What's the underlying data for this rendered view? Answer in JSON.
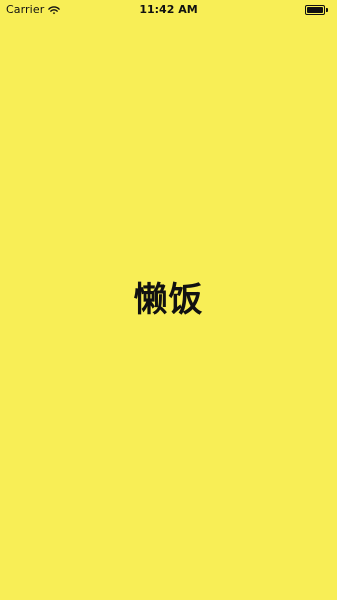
{
  "status_bar": {
    "carrier": "Carrier",
    "time": "11:42 AM",
    "battery_level": 1.0
  },
  "splash": {
    "app_name": "懒饭"
  },
  "colors": {
    "background": "#f8ee56",
    "text": "#111111"
  },
  "icons": {
    "wifi": "wifi-icon",
    "battery": "battery-icon"
  }
}
